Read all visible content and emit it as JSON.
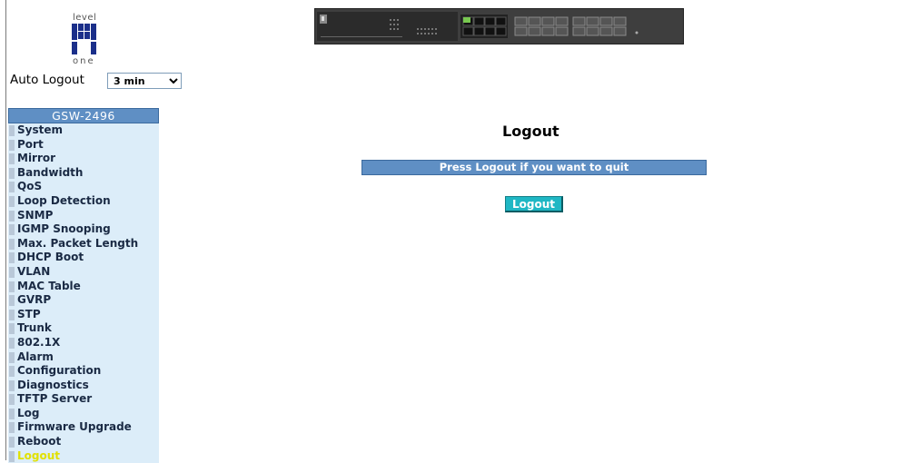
{
  "brand": {
    "logo_top": "level",
    "logo_bottom": "one"
  },
  "auto_logout": {
    "label": "Auto Logout",
    "selected": "3 min"
  },
  "menu": {
    "title": "GSW-2496",
    "items": [
      {
        "label": "System"
      },
      {
        "label": "Port"
      },
      {
        "label": "Mirror"
      },
      {
        "label": "Bandwidth"
      },
      {
        "label": "QoS"
      },
      {
        "label": "Loop Detection"
      },
      {
        "label": "SNMP"
      },
      {
        "label": "IGMP Snooping"
      },
      {
        "label": "Max. Packet Length"
      },
      {
        "label": "DHCP Boot"
      },
      {
        "label": "VLAN"
      },
      {
        "label": "MAC Table"
      },
      {
        "label": "GVRP"
      },
      {
        "label": "STP"
      },
      {
        "label": "Trunk"
      },
      {
        "label": "802.1X"
      },
      {
        "label": "Alarm"
      },
      {
        "label": "Configuration"
      },
      {
        "label": "Diagnostics"
      },
      {
        "label": "TFTP Server"
      },
      {
        "label": "Log"
      },
      {
        "label": "Firmware Upgrade"
      },
      {
        "label": "Reboot"
      },
      {
        "label": "Logout",
        "active": true
      }
    ]
  },
  "main": {
    "title": "Logout",
    "info": "Press Logout if you want to quit",
    "button_label": "Logout"
  },
  "colors": {
    "menu_bg": "#dcedf9",
    "header_blue": "#5f8fc4",
    "button_teal": "#1fb7c4",
    "active_item": "#e1e100"
  }
}
